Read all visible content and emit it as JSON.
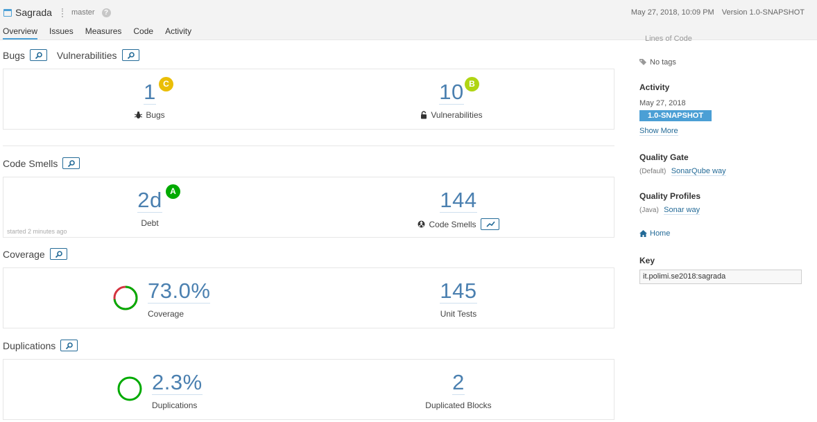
{
  "header": {
    "project_name": "Sagrada",
    "branch": "master",
    "help_symbol": "?",
    "date": "May 27, 2018, 10:09 PM",
    "version": "Version 1.0-SNAPSHOT"
  },
  "tabs": [
    {
      "label": "Overview",
      "active": true
    },
    {
      "label": "Issues"
    },
    {
      "label": "Measures"
    },
    {
      "label": "Code"
    },
    {
      "label": "Activity"
    }
  ],
  "sections": {
    "bugs_title": "Bugs",
    "vulnerabilities_title": "Vulnerabilities",
    "code_smells_title": "Code Smells",
    "coverage_title": "Coverage",
    "duplications_title": "Duplications"
  },
  "bugs": {
    "value": "1",
    "rating": "C",
    "label": "Bugs"
  },
  "vulnerabilities": {
    "value": "10",
    "rating": "B",
    "label": "Vulnerabilities"
  },
  "debt": {
    "value": "2d",
    "rating": "A",
    "label": "Debt",
    "started": "started 2 minutes ago"
  },
  "code_smells": {
    "value": "144",
    "label": "Code Smells"
  },
  "coverage": {
    "value": "73.0%",
    "label": "Coverage",
    "fraction": 0.73
  },
  "unit_tests": {
    "value": "145",
    "label": "Unit Tests"
  },
  "duplications": {
    "value": "2.3%",
    "label": "Duplications",
    "fraction": 0.023
  },
  "duplicated_blocks": {
    "value": "2",
    "label": "Duplicated Blocks"
  },
  "sidebar": {
    "cut_text": "Lines of Code",
    "tags": "No tags",
    "activity_title": "Activity",
    "activity_date": "May 27, 2018",
    "activity_version": "1.0-SNAPSHOT",
    "show_more": "Show More",
    "quality_gate_title": "Quality Gate",
    "quality_gate_default": "(Default)",
    "quality_gate_link": "SonarQube way",
    "quality_profiles_title": "Quality Profiles",
    "quality_profiles_lang": "(Java)",
    "quality_profiles_link": "Sonar way",
    "home_link": "Home",
    "key_title": "Key",
    "key_value": "it.polimi.se2018:sagrada"
  },
  "colors": {
    "accent": "#4b9fd5",
    "rating_a": "#00aa00",
    "rating_b": "#b0d513",
    "rating_c": "#eabe06",
    "coverage_covered": "#00aa00",
    "coverage_uncovered": "#d4333f"
  }
}
